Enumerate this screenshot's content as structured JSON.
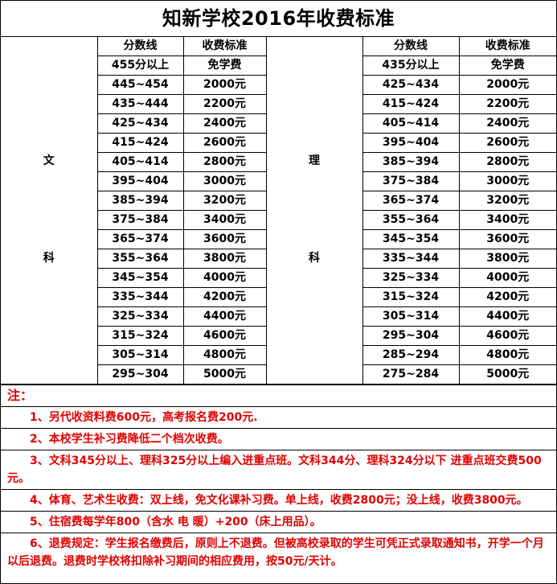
{
  "title": "知新学校2016年收费标准",
  "headers": {
    "score": "分数线",
    "fee": "收费标准"
  },
  "wen": {
    "label_top": "文",
    "label_bottom": "科",
    "rows": [
      {
        "score": "455分以上",
        "fee": "免学费"
      },
      {
        "score": "445~454",
        "fee": "2000元"
      },
      {
        "score": "435~444",
        "fee": "2200元"
      },
      {
        "score": "425~434",
        "fee": "2400元"
      },
      {
        "score": "415~424",
        "fee": "2600元"
      },
      {
        "score": "405~414",
        "fee": "2800元"
      },
      {
        "score": "395~404",
        "fee": "3000元"
      },
      {
        "score": "385~394",
        "fee": "3200元"
      },
      {
        "score": "375~384",
        "fee": "3400元"
      },
      {
        "score": "365~374",
        "fee": "3600元"
      },
      {
        "score": "355~364",
        "fee": "3800元"
      },
      {
        "score": "345~354",
        "fee": "4000元"
      },
      {
        "score": "335~344",
        "fee": "4200元"
      },
      {
        "score": "325~334",
        "fee": "4400元"
      },
      {
        "score": "315~324",
        "fee": "4600元"
      },
      {
        "score": "305~314",
        "fee": "4800元"
      },
      {
        "score": "295~304",
        "fee": "5000元"
      }
    ]
  },
  "li": {
    "label_top": "理",
    "label_bottom": "科",
    "rows": [
      {
        "score": "435分以上",
        "fee": "免学费"
      },
      {
        "score": "425~434",
        "fee": "2000元"
      },
      {
        "score": "415~424",
        "fee": "2200元"
      },
      {
        "score": "405~414",
        "fee": "2400元"
      },
      {
        "score": "395~404",
        "fee": "2600元"
      },
      {
        "score": "385~394",
        "fee": "2800元"
      },
      {
        "score": "375~384",
        "fee": "3000元"
      },
      {
        "score": "365~374",
        "fee": "3200元"
      },
      {
        "score": "355~364",
        "fee": "3400元"
      },
      {
        "score": "345~354",
        "fee": "3600元"
      },
      {
        "score": "335~344",
        "fee": "3800元"
      },
      {
        "score": "325~334",
        "fee": "4000元"
      },
      {
        "score": "315~324",
        "fee": "4200元"
      },
      {
        "score": "305~314",
        "fee": "4400元"
      },
      {
        "score": "295~304",
        "fee": "4600元"
      },
      {
        "score": "285~294",
        "fee": "4800元"
      },
      {
        "score": "275~284",
        "fee": "5000元"
      }
    ]
  },
  "notes": {
    "heading": "注：",
    "items": [
      "1、另代收资料费600元，高考报名费200元.",
      "2、本校学生补习费降低二个档次收费。",
      "3、文科345分以上、理科325分以上编入进重点班。文科344分、理科324分以下 进重点班交费500元。",
      "4、体育、艺术生收费：双上线，免文化课补习费。单上线，收费2800元；没上线，收费3800元。",
      "5、住宿费每学年800（含水 电 暖）+200（床上用品）。",
      "6、退费规定：学生报名缴费后，原则上不退费。但被高校录取的学生可凭正式录取通知书，开学一个月以后退费。退费时学校将扣除补习期间的相应费用，按50元/天计。"
    ]
  }
}
